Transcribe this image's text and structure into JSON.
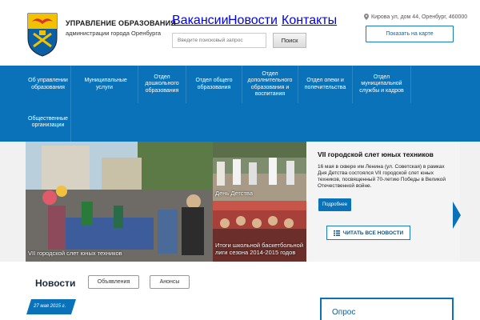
{
  "header": {
    "org_title": "УПРАВЛЕНИЕ ОБРАЗОВАНИЯ",
    "org_subtitle": "администрации города Оренбурга",
    "topnav": [
      "Вакансии",
      "Новости",
      "Контакты"
    ],
    "search": {
      "placeholder": "Введите поисковый запрос",
      "button": "Поиск"
    },
    "address": "Кирова ул, дом 44, Оренбург, 460000",
    "map_button": "Показать на карте"
  },
  "mainnav": [
    "Об управлении образования",
    "Муниципальные услуги",
    "Отдел дошкольного образования",
    "Отдел общего образования",
    "Отдел дополнительного образования и воспитания",
    "Отдел опеки и попечительства",
    "Отдел муниципальной службы и кадров",
    "Общественные организации"
  ],
  "slider": {
    "main_caption": "VII городской слет юных техников",
    "top_caption": "День Детства",
    "bottom_caption": "Итоги школьной баскетбольной лиги сезона 2014-2015 годов",
    "feature_title": "VII городской слет юных техников",
    "feature_text": "16 мая в сквере им Ленина (ул. Советская) в рамках Дня Детства состоялся VII городской слет юных техников, посвященный 70-летию Победы в Великой Отечественной войне.",
    "more_button": "Подробнее",
    "all_news_button": "ЧИТАТЬ ВСЕ НОВОСТИ"
  },
  "news": {
    "heading": "Новости",
    "tabs": [
      "Объявления",
      "Анонсы"
    ],
    "date": "27 мая 2015 г."
  },
  "poll": {
    "title": "Опрос"
  },
  "colors": {
    "primary": "#0a72b9",
    "accent_border": "#1a7bbf",
    "gold": "#f2c200"
  }
}
